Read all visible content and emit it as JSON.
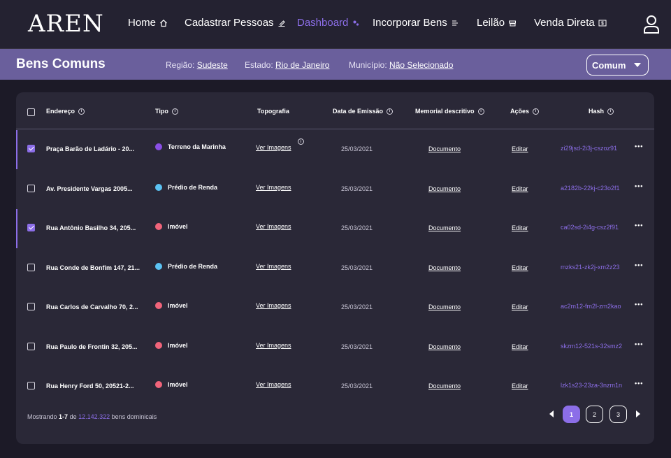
{
  "app": {
    "logo": "AREN"
  },
  "nav": {
    "items": [
      {
        "label": "Home",
        "icon": "home-icon",
        "active": false
      },
      {
        "label": "Cadastrar Pessoas",
        "icon": "edit-icon",
        "active": false
      },
      {
        "label": "Dashboard",
        "icon": "dashboard-icon",
        "active": true
      },
      {
        "label": "Incorporar Bens",
        "icon": "incorporate-icon",
        "active": false
      },
      {
        "label": "Leilão",
        "icon": "auction-icon",
        "active": false
      },
      {
        "label": "Venda Direta",
        "icon": "sale-icon",
        "active": false
      }
    ],
    "user_icon": "user-icon"
  },
  "subheader": {
    "title": "Bens Comuns",
    "regiao_label": "Região:",
    "regiao_value": "Sudeste",
    "estado_label": "Estado:",
    "estado_value": "Rio de Janeiro",
    "municipio_label": "Município:",
    "municipio_value": "Não Selecionado",
    "select_value": "Comum"
  },
  "table": {
    "headers": {
      "endereco": "Endereço",
      "tipo": "Tipo",
      "topografia": "Topografia",
      "data": "Data de Emissão",
      "memorial": "Memorial descritivo",
      "acoes": "Ações",
      "hash": "Hash"
    },
    "rows": [
      {
        "selected": true,
        "endereco": "Praça Barão de Ladário - 20...",
        "tipo": "Terreno da Marinha",
        "tipo_color": "#8a4fe6",
        "topografia": "Ver Imagens",
        "data": "25/03/2021",
        "memorial": "Documento",
        "acao": "Editar",
        "hash": "zi29jsd-2i3j-cszoz91"
      },
      {
        "selected": false,
        "endereco": "Av. Presidente Vargas 2005...",
        "tipo": "Prédio de Renda",
        "tipo_color": "#5bc2f2",
        "topografia": "Ver Imagens",
        "data": "25/03/2021",
        "memorial": "Documento",
        "acao": "Editar",
        "hash": "a2182b-22kj-c23o2f1"
      },
      {
        "selected": true,
        "endereco": "Rua Antônio Basilho 34, 205...",
        "tipo": "Imóvel",
        "tipo_color": "#f0647a",
        "topografia": "Ver Imagens",
        "data": "25/03/2021",
        "memorial": "Documento",
        "acao": "Editar",
        "hash": "ca02sd-2i4g-csz2f91"
      },
      {
        "selected": false,
        "endereco": "Rua Conde de Bonfim 147, 21...",
        "tipo": "Prédio de Renda",
        "tipo_color": "#5bc2f2",
        "topografia": "Ver Imagens",
        "data": "25/03/2021",
        "memorial": "Documento",
        "acao": "Editar",
        "hash": "mzks21-zk2j-xm2z23"
      },
      {
        "selected": false,
        "endereco": "Rua Carlos de Carvalho 70, 2...",
        "tipo": "Imóvel",
        "tipo_color": "#f0647a",
        "topografia": "Ver Imagens",
        "data": "25/03/2021",
        "memorial": "Documento",
        "acao": "Editar",
        "hash": "ac2m12-fm2l-zm2kao"
      },
      {
        "selected": false,
        "endereco": "Rua Paulo de Frontin 32, 205...",
        "tipo": "Imóvel",
        "tipo_color": "#f0647a",
        "topografia": "Ver Imagens",
        "data": "25/03/2021",
        "memorial": "Documento",
        "acao": "Editar",
        "hash": "skzm12-521s-32smz2"
      },
      {
        "selected": false,
        "endereco": "Rua Henry Ford 50, 20521-2...",
        "tipo": "Imóvel",
        "tipo_color": "#f0647a",
        "topografia": "Ver Imagens",
        "data": "25/03/2021",
        "memorial": "Documento",
        "acao": "Editar",
        "hash": "lzk1s23-23za-3nzm1n"
      }
    ]
  },
  "footer": {
    "prefix": "Mostrando",
    "range": "1-7",
    "of": "de",
    "total": "12.142.322",
    "suffix": "bens dominicais",
    "pages": [
      "1",
      "2",
      "3"
    ],
    "current_page": "1"
  },
  "colors": {
    "accent": "#8c6ee8",
    "subheader": "#6a5f9c",
    "background": "#1c1a27",
    "card": "#2a2837"
  }
}
